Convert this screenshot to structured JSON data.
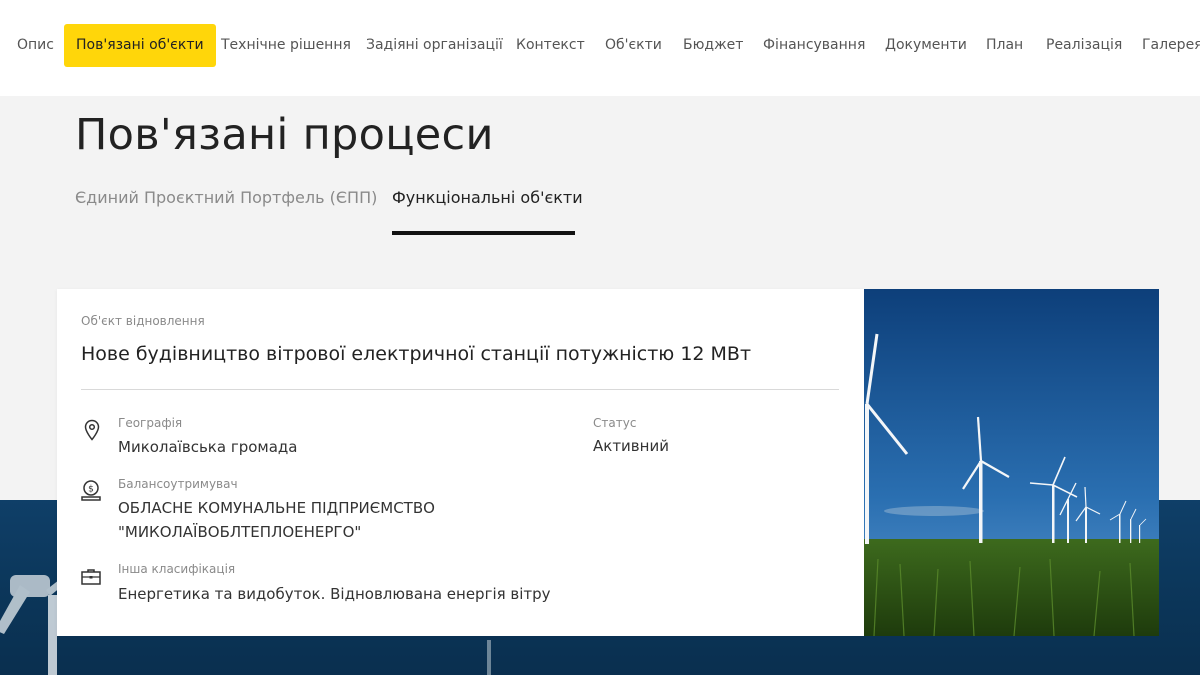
{
  "nav": {
    "items": [
      {
        "label": "Опис",
        "active": false
      },
      {
        "label": "Пов'язані об'єкти",
        "active": true
      },
      {
        "label": "Технічне рішення",
        "active": false
      },
      {
        "label": "Задіяні організації",
        "active": false
      },
      {
        "label": "Контекст",
        "active": false
      },
      {
        "label": "Об'єкти",
        "active": false
      },
      {
        "label": "Бюджет",
        "active": false
      },
      {
        "label": "Фінансування",
        "active": false
      },
      {
        "label": "Документи",
        "active": false
      },
      {
        "label": "План",
        "active": false
      },
      {
        "label": "Реалізація",
        "active": false
      },
      {
        "label": "Галерея",
        "active": false
      }
    ],
    "active_color": "#ffd60a"
  },
  "page": {
    "title": "Пов'язані процеси",
    "tabs": [
      {
        "label": "Єдиний Проєктний Портфель (ЄПП)",
        "active": false
      },
      {
        "label": "Функціональні об'єкти",
        "active": true
      }
    ]
  },
  "card": {
    "category": "Об'єкт відновлення",
    "title": "Нове будівництво вітрової електричної станції потужністю 12 МВт",
    "geography": {
      "label": "Географія",
      "value": "Миколаївська громада",
      "icon": "location-pin-icon"
    },
    "status": {
      "label": "Статус",
      "value": "Активний"
    },
    "holder": {
      "label": "Балансоутримувач",
      "value_line1": "ОБЛАСНЕ КОМУНАЛЬНЕ ПІДПРИЄМСТВО",
      "value_line2": "\"МИКОЛАЇВОБЛТЕПЛОЕНЕРГО\"",
      "icon": "money-bag-icon"
    },
    "classification": {
      "label": "Інша класифікація",
      "value": "Енергетика та видобуток. Відновлювана енергія вітру",
      "icon": "briefcase-icon"
    }
  },
  "colors": {
    "accent": "#ffd60a",
    "background": "#f3f3f3",
    "footer_blue": "#0f3f68"
  }
}
